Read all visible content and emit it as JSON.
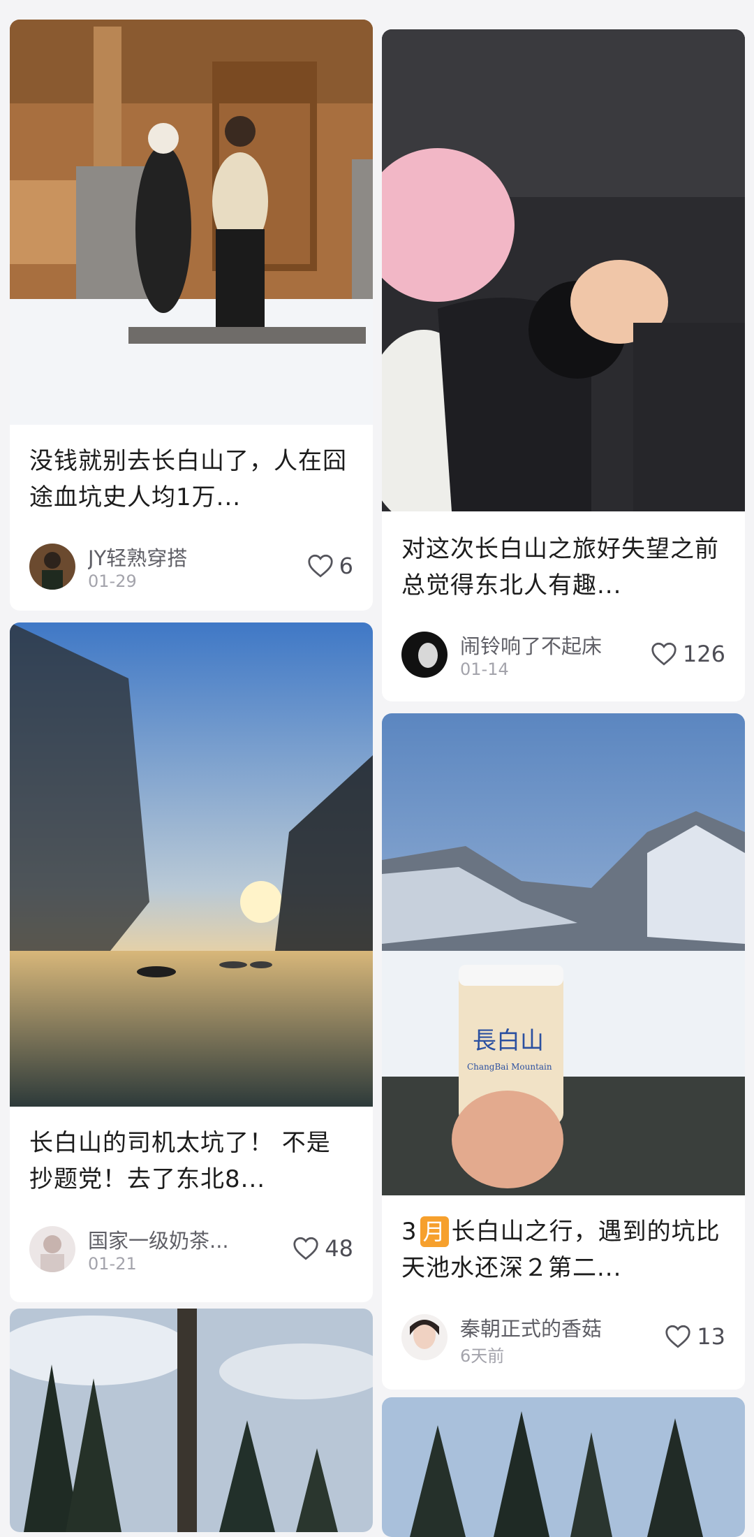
{
  "feed": {
    "left": [
      {
        "title": "没钱就别去长白山了，人在囧途血坑史人均1万...",
        "author": "JY轻熟穿搭",
        "date": "01-29",
        "likes": "6"
      },
      {
        "title": "长白山的司机太坑了！ 不是抄题党！去了东北8...",
        "author": "国家一级奶茶...",
        "date": "01-21",
        "likes": "48"
      }
    ],
    "right": [
      {
        "title": "对这次长白山之旅好失望之前总觉得东北人有趣...",
        "author": "闹铃响了不起床",
        "date": "01-14",
        "likes": "126"
      },
      {
        "title_num": "3",
        "title_badge": "月",
        "title_rest": "长白山之行，遇到的坑比天池水还深２第二...",
        "author": "秦朝正式的香菇",
        "date": "6天前",
        "likes": "13",
        "cup_text": "長白山",
        "cup_sub": "ChangBai Mountain"
      }
    ]
  },
  "colors": {
    "background": "#f4f4f6",
    "card": "#ffffff",
    "title": "#1c1c1c",
    "meta": "#a3a3ab",
    "badge": "#f6a02d"
  },
  "icons": [
    "heart-outline-icon"
  ]
}
